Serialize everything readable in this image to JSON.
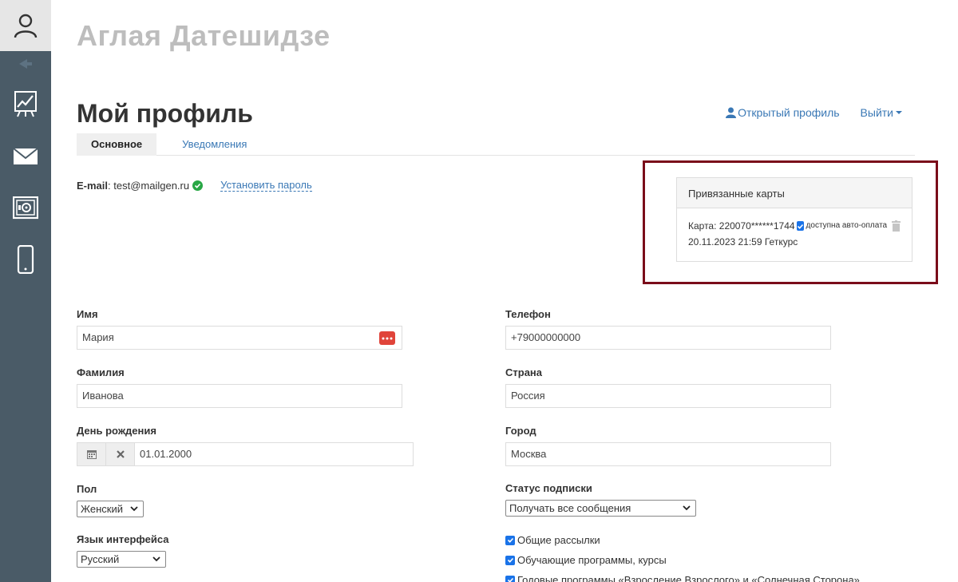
{
  "sidebar": {
    "icons": [
      "user-avatar-icon",
      "collapse-arrow-icon",
      "chart-icon",
      "mail-icon",
      "safe-icon",
      "mobile-icon"
    ]
  },
  "header": {
    "user_name": "Аглая Датешидзе",
    "page_title": "Мой профиль",
    "open_profile": "Открытый профиль",
    "logout": "Выйти"
  },
  "tabs": [
    {
      "label": "Основное"
    },
    {
      "label": "Уведомления"
    }
  ],
  "email": {
    "label": "E-mail",
    "value": "test@mailgen.ru",
    "set_password": "Установить пароль"
  },
  "cards": {
    "title": "Привязанные карты",
    "card_text": "Карта: 220070******1744",
    "auto_pay": "доступна авто-оплата",
    "date_line": "20.11.2023 21:59 Геткурс"
  },
  "form": {
    "first_name": {
      "label": "Имя",
      "value": "Мария"
    },
    "last_name": {
      "label": "Фамилия",
      "value": "Иванова"
    },
    "birthday": {
      "label": "День рождения",
      "value": "01.01.2000"
    },
    "gender": {
      "label": "Пол",
      "value": "Женский"
    },
    "language": {
      "label": "Язык интерфейса",
      "value": "Русский"
    },
    "phone": {
      "label": "Телефон",
      "value": "+79000000000"
    },
    "country": {
      "label": "Страна",
      "value": "Россия"
    },
    "city": {
      "label": "Город",
      "value": "Москва"
    },
    "subscription": {
      "label": "Статус подписки",
      "value": "Получать все сообщения"
    },
    "checkboxes": [
      {
        "label": "Общие рассылки",
        "checked": true
      },
      {
        "label": "Обучающие программы, курсы",
        "checked": true
      },
      {
        "label": "Годовые программы «Взросление Взрослого» и «Солнечная Сторона»",
        "checked": true
      }
    ]
  },
  "colors": {
    "sidebar": "#4a5b67",
    "link": "#3a78b5",
    "highlight_border": "#7a0c1a",
    "success": "#28a745",
    "danger": "#e0443a",
    "checkbox": "#1a73e8"
  }
}
